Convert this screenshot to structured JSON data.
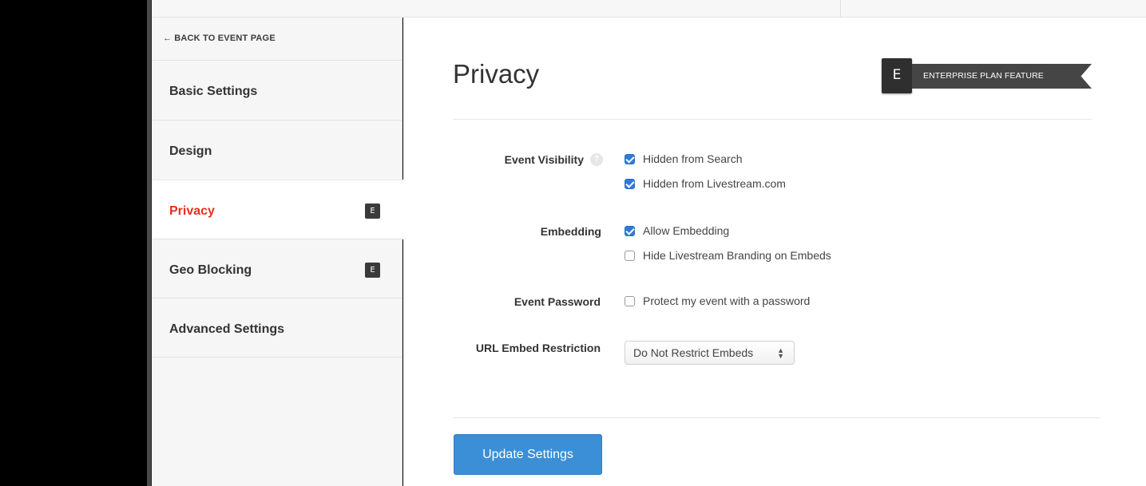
{
  "sidebar": {
    "back_label": "BACK TO EVENT PAGE",
    "back_arrow": "←",
    "items": [
      {
        "label": "Basic Settings",
        "badge": ""
      },
      {
        "label": "Design",
        "badge": ""
      },
      {
        "label": "Privacy",
        "badge": "E",
        "active": true
      },
      {
        "label": "Geo Blocking",
        "badge": "E"
      },
      {
        "label": "Advanced Settings",
        "badge": ""
      }
    ]
  },
  "main": {
    "title": "Privacy",
    "plan_tag": {
      "letter": "E",
      "text": "ENTERPRISE PLAN FEATURE"
    },
    "rows": {
      "visibility": {
        "label": "Event Visibility",
        "help_glyph": "?",
        "options": [
          {
            "label": "Hidden from Search",
            "checked": true
          },
          {
            "label": "Hidden from Livestream.com",
            "checked": true
          }
        ]
      },
      "embedding": {
        "label": "Embedding",
        "options": [
          {
            "label": "Allow Embedding",
            "checked": true
          },
          {
            "label": "Hide Livestream Branding on Embeds",
            "checked": false
          }
        ]
      },
      "password": {
        "label": "Event Password",
        "options": [
          {
            "label": "Protect my event with a password",
            "checked": false
          }
        ]
      },
      "url_restriction": {
        "label": "URL Embed Restriction",
        "selected": "Do Not Restrict Embeds",
        "caret": "▲▼"
      }
    },
    "submit_label": "Update Settings"
  },
  "colors": {
    "accent": "#3b8fd6",
    "active_nav": "#e62e1f",
    "checkbox": "#2f7ad8",
    "badge": "#3a3a3a"
  }
}
